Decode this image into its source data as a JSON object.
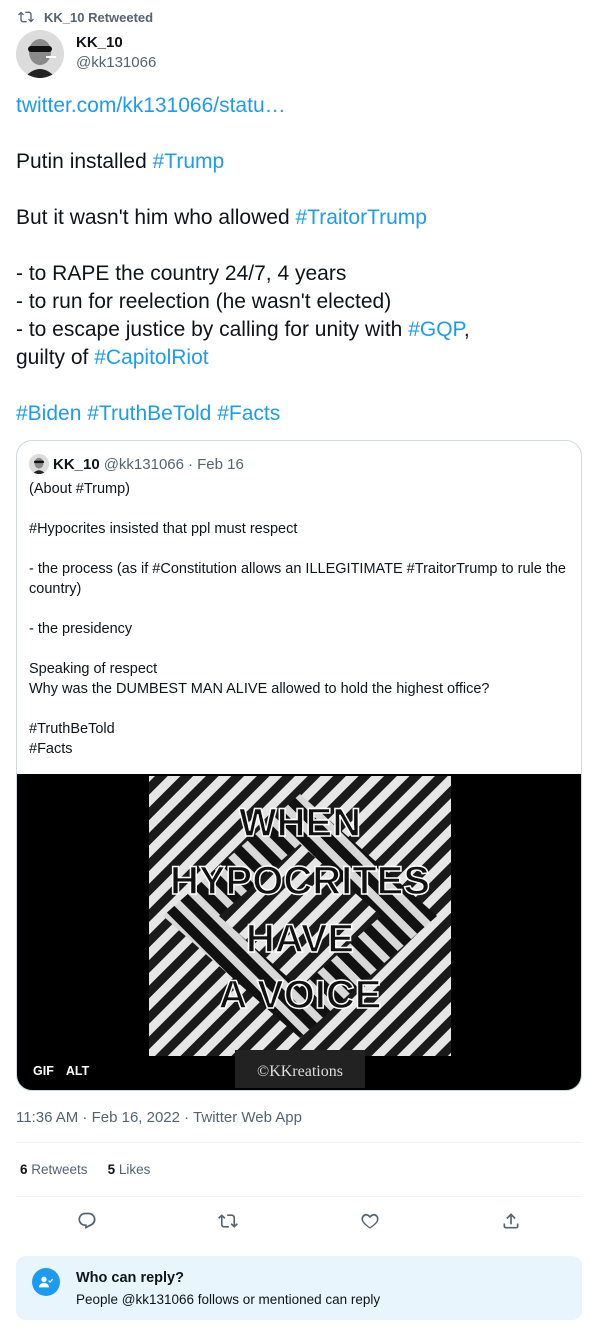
{
  "retweet_header": {
    "label": "KK_10 Retweeted"
  },
  "author": {
    "name": "KK_10",
    "handle": "@kk131066"
  },
  "tweet": {
    "link": "twitter.com/kk131066/statu…",
    "line1_prefix": "Putin installed ",
    "line1_tag": "#Trump",
    "line2_prefix": "But it wasn't him who allowed ",
    "line2_tag": "#TraitorTrump",
    "bullet1": "- to RAPE the country 24/7, 4 years",
    "bullet2": "- to run for reelection (he wasn't elected)",
    "bullet3_prefix": "- to escape justice by calling for unity with ",
    "bullet3_tag": "#GQP",
    "bullet3_suffix": ",",
    "bullet4_prefix": "guilty of ",
    "bullet4_tag": "#CapitolRiot",
    "tags_line": [
      "#Biden",
      "#TruthBeTold",
      "#Facts"
    ]
  },
  "quote": {
    "name": "KK_10",
    "handle": "@kk131066",
    "date": "· Feb 16",
    "lines": [
      "(About #Trump)",
      "",
      "#Hypocrites insisted that ppl must respect",
      "",
      "- the process (as if #Constitution allows an ILLEGITIMATE #TraitorTrump to rule the country)",
      "",
      "- the presidency",
      "",
      "Speaking of respect",
      "Why was the DUMBEST MAN ALIVE allowed to hold the highest office?",
      "",
      "#TruthBeTold",
      "#Facts"
    ],
    "media_text": [
      "WHEN",
      "HYPOCRITES",
      "HAVE",
      "A VOICE"
    ],
    "media_watermark": "©KKreations",
    "badges": [
      "GIF",
      "ALT"
    ]
  },
  "timestamp": "11:36 AM · Feb 16, 2022 · Twitter Web App",
  "stats": {
    "retweets_count": "6",
    "retweets_label": "Retweets",
    "likes_count": "5",
    "likes_label": "Likes"
  },
  "who_can_reply": {
    "title": "Who can reply?",
    "description": "People @kk131066 follows or mentioned can reply"
  },
  "colors": {
    "accent": "#1d9bf0",
    "muted": "#536471",
    "reply_bg": "#e8f5fd"
  },
  "icons": [
    "retweet-icon",
    "reply-icon",
    "like-icon",
    "share-icon",
    "person-check-icon"
  ]
}
